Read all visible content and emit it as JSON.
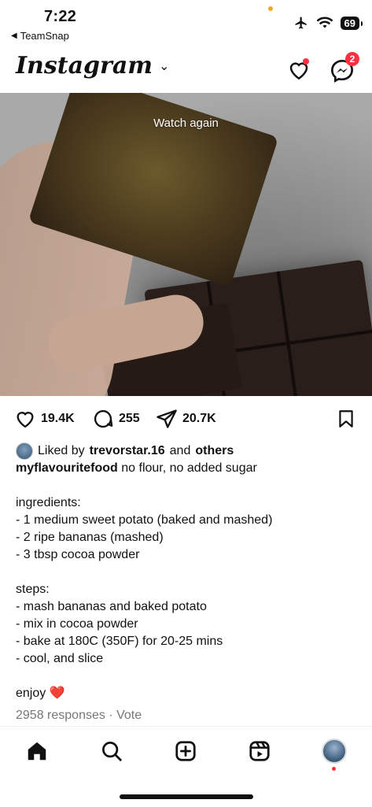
{
  "status": {
    "time": "7:22",
    "back_app": "TeamSnap",
    "battery": "69"
  },
  "header": {
    "logo": "Instagram",
    "messages_badge": "2"
  },
  "media": {
    "overlay_text": "Watch again"
  },
  "actions": {
    "likes": "19.4K",
    "comments": "255",
    "shares": "20.7K"
  },
  "caption": {
    "liked_prefix": "Liked by",
    "liked_user": "trevorstar.16",
    "liked_and": "and",
    "liked_others": "others",
    "author": "myflavouritefood",
    "first_line": "no flour, no added sugar",
    "ingredients_title": "ingredients:",
    "ingredients": [
      "- 1 medium sweet potato (baked and mashed)",
      "- 2 ripe bananas (mashed)",
      "- 3 tbsp cocoa powder"
    ],
    "steps_title": "steps:",
    "steps": [
      "- mash bananas and baked potato",
      "- mix in cocoa powder",
      "- bake at 180C (350F) for 20-25 mins",
      "- cool, and slice"
    ],
    "enjoy": "enjoy",
    "enjoy_emoji": "❤️",
    "responses": "2958 responses · Vote"
  },
  "colors": {
    "notification_red": "#ff3040",
    "heart_red": "#e3202f"
  },
  "icons": [
    "airplane-icon",
    "wifi-icon",
    "heart-icon",
    "messenger-icon",
    "comment-icon",
    "send-icon",
    "bookmark-icon",
    "home-icon",
    "search-icon",
    "create-icon",
    "reels-icon"
  ]
}
